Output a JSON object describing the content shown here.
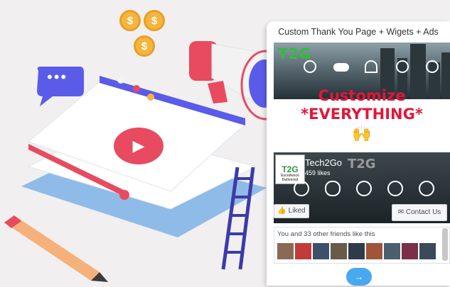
{
  "illustration": {
    "coin_symbol": "$",
    "chat_dots": "•••",
    "play_symbol": "▶"
  },
  "panel": {
    "title": "Custom Thank You Page + Wigets + Ads",
    "banner_logo": "T2G",
    "headline_line1": "Customize",
    "headline_line2": "*EVERYTHING*",
    "emoji": "🙌"
  },
  "facebook_widget": {
    "page_logo": "T2G",
    "page_logo_caption": "Excellence Delivered",
    "page_name": "Tech2Go",
    "likes": "459 likes",
    "overlay_logo": "T2G",
    "liked_button": "Liked",
    "contact_button": "Contact Us",
    "friends_text": "You and 33 other friends like this"
  },
  "next_button": "→",
  "colors": {
    "accent_red": "#e1173a",
    "accent_blue": "#48a8f0",
    "megaphone_red": "#e84a5f",
    "purple": "#5a5be8"
  }
}
